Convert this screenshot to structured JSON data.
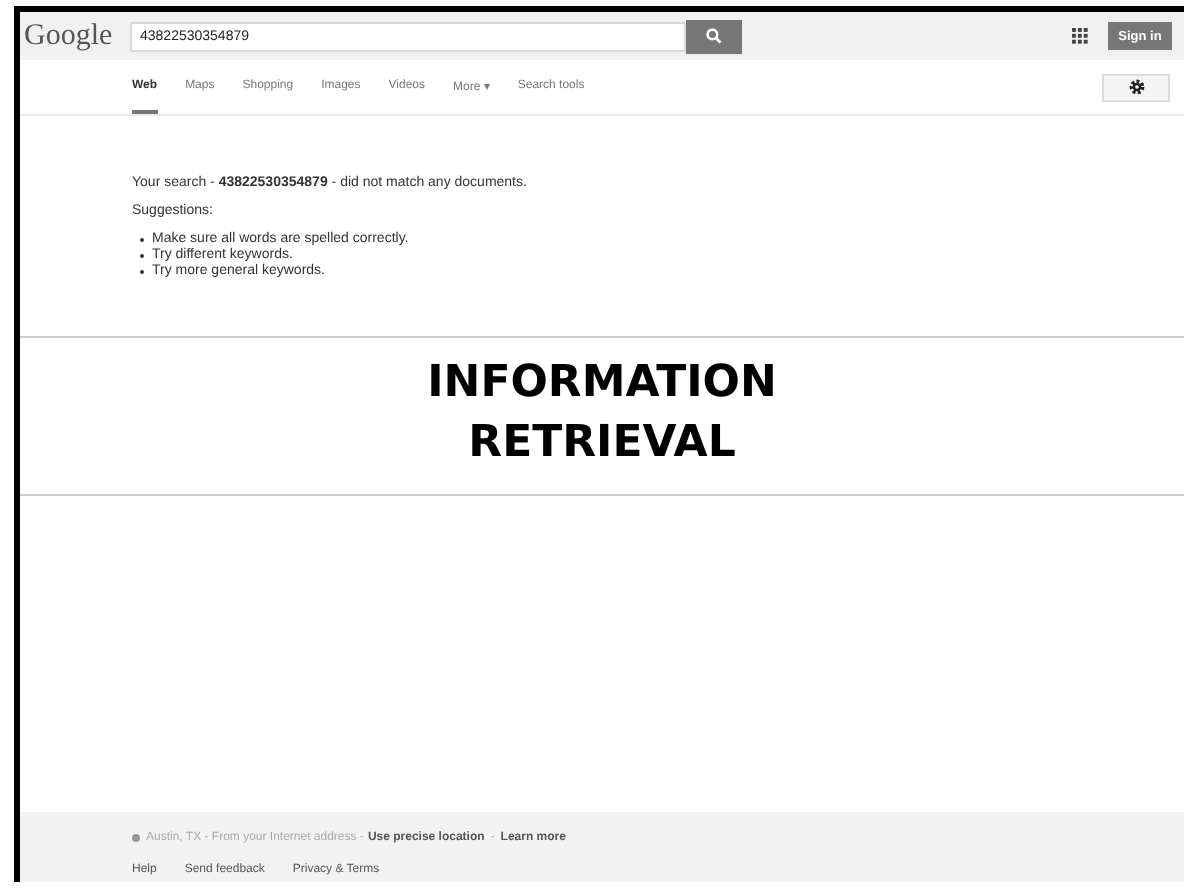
{
  "header": {
    "logo": "Google",
    "search": {
      "value": "43822530354879"
    },
    "sign_in": "Sign in"
  },
  "tabs": [
    {
      "label": "Web",
      "selected": true
    },
    {
      "label": "Maps",
      "selected": false
    },
    {
      "label": "Shopping",
      "selected": false
    },
    {
      "label": "Images",
      "selected": false
    },
    {
      "label": "Videos",
      "selected": false
    },
    {
      "label": "More ▾",
      "selected": false
    },
    {
      "label": "Search tools",
      "selected": false
    }
  ],
  "results": {
    "message": "Your search - **43822530354879** - did not match any documents.",
    "suggestions_title": "Suggestions:",
    "suggestions": [
      "Make sure all words are spelled correctly.",
      "Try different keywords.",
      "Try more general keywords."
    ]
  },
  "overlay_title": [
    "INFORMATION",
    "RETRIEVAL"
  ],
  "footer": {
    "location": "Austin, TX - From your Internet address - ",
    "location_links": [
      "Use precise location",
      "Learn more"
    ],
    "separator": "-",
    "links": [
      "Help",
      "Send feedback",
      "Privacy & Terms"
    ]
  }
}
